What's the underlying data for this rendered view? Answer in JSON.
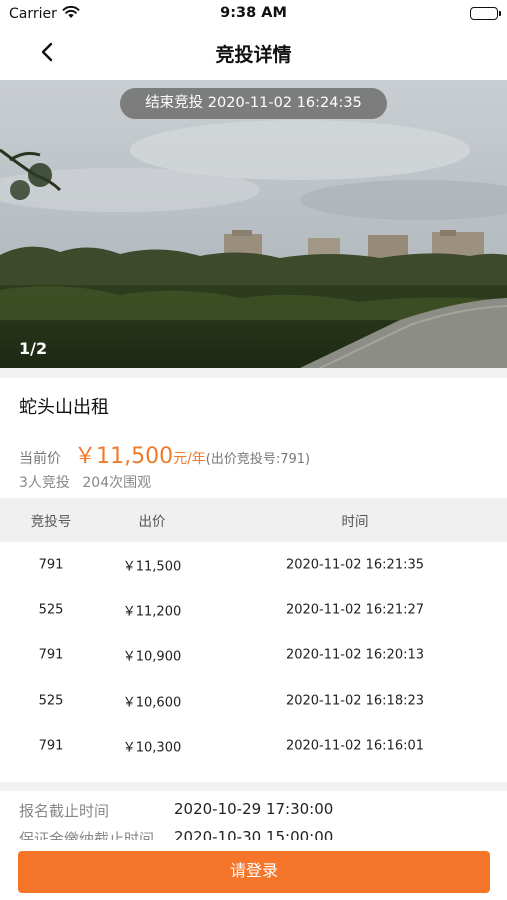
{
  "status_bar": {
    "carrier": "Carrier",
    "time": "9:38 AM",
    "battery_level": 1.0
  },
  "nav": {
    "title": "竞投详情"
  },
  "hero": {
    "end_banner": "结束竞投 2020-11-02 16:24:35",
    "counter": "1/2"
  },
  "listing": {
    "title": "蛇头山出租",
    "price_label": "当前价",
    "price_value": "￥11,500",
    "price_unit": "元/年",
    "price_note": "(出价竞投号:791)",
    "bidders": "3人竞投",
    "views": "204次围观"
  },
  "bid_table": {
    "headers": [
      "竞投号",
      "出价",
      "时间"
    ],
    "rows": [
      {
        "bid_no": "791",
        "price": "￥11,500",
        "time": "2020-11-02 16:21:35"
      },
      {
        "bid_no": "525",
        "price": "￥11,200",
        "time": "2020-11-02 16:21:27"
      },
      {
        "bid_no": "791",
        "price": "￥10,900",
        "time": "2020-11-02 16:20:13"
      },
      {
        "bid_no": "525",
        "price": "￥10,600",
        "time": "2020-11-02 16:18:23"
      },
      {
        "bid_no": "791",
        "price": "￥10,300",
        "time": "2020-11-02 16:16:01"
      }
    ]
  },
  "info": [
    {
      "label": "报名截止时间",
      "value": "2020-10-29 17:30:00"
    },
    {
      "label": "保证金缴纳截止时间",
      "value": "2020-10-30 15:00:00"
    }
  ],
  "footer": {
    "login_label": "请登录"
  },
  "colors": {
    "accent": "#f5762a",
    "price": "#f07a2a"
  }
}
